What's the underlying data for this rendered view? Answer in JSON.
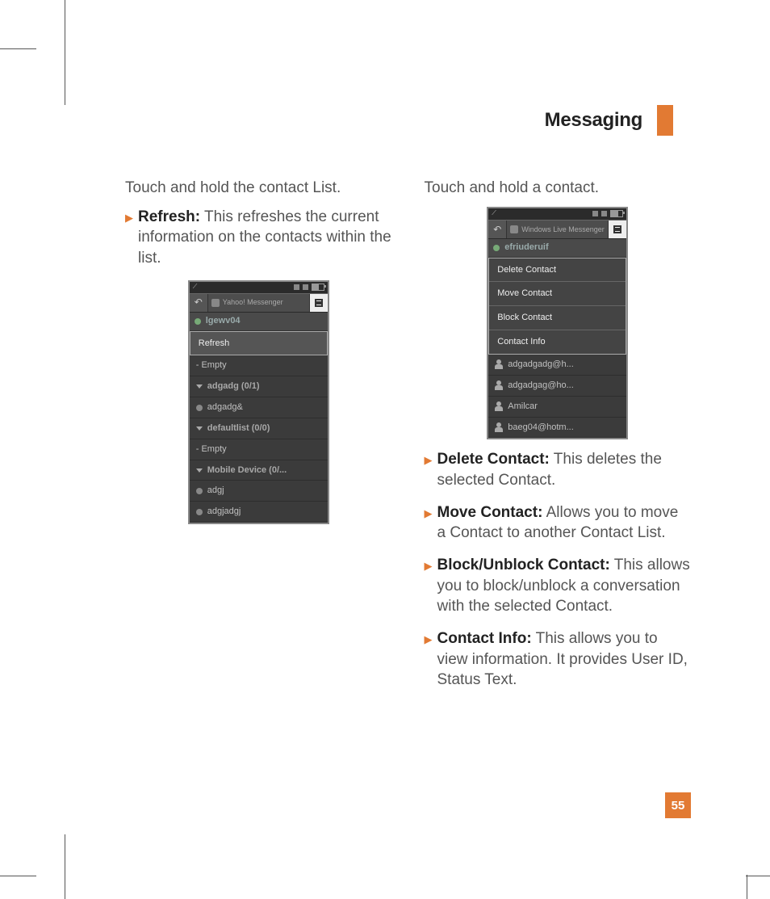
{
  "header": {
    "title": "Messaging"
  },
  "page_number": "55",
  "left": {
    "lead": "Touch and hold the contact List.",
    "bullets": [
      {
        "head": "Refresh:",
        "body": " This refreshes the current information on the contacts within the list."
      }
    ],
    "shot": {
      "app_title": "Yahoo! Messenger",
      "user": "lgewv04",
      "popup_items": [
        "Refresh"
      ],
      "list": [
        {
          "type": "sub",
          "label": "-   Empty"
        },
        {
          "type": "grp",
          "label": "adgadg (0/1)"
        },
        {
          "type": "sub",
          "icon": "dot",
          "label": "adgadg&"
        },
        {
          "type": "grp",
          "label": "defaultlist (0/0)"
        },
        {
          "type": "sub",
          "label": "-   Empty"
        },
        {
          "type": "grp",
          "label": "Mobile Device (0/..."
        },
        {
          "type": "sub",
          "icon": "dot",
          "label": "adgj"
        },
        {
          "type": "sub",
          "icon": "dot",
          "label": "adgjadgj"
        }
      ]
    }
  },
  "right": {
    "lead": "Touch and hold a contact.",
    "bullets": [
      {
        "head": "Delete Contact:",
        "body": " This deletes the selected Contact."
      },
      {
        "head": "Move Contact:",
        "body": " Allows you to move a Contact to another Contact List."
      },
      {
        "head": "Block/Unblock Contact:",
        "body": " This allows you to block/unblock a conversation with the selected Contact."
      },
      {
        "head": "Contact Info:",
        "body": " This allows you to view information. It provides User ID, Status Text."
      }
    ],
    "shot": {
      "app_title": "Windows Live Messenger",
      "user": "efriuderuif",
      "popup_items": [
        "Delete Contact",
        "Move Contact",
        "Block Contact",
        "Contact Info"
      ],
      "list": [
        {
          "type": "sub",
          "icon": "person",
          "label": "adgadgadg@h..."
        },
        {
          "type": "sub",
          "icon": "person",
          "label": "adgadgag@ho..."
        },
        {
          "type": "sub",
          "icon": "person",
          "label": "Amilcar"
        },
        {
          "type": "sub",
          "icon": "person",
          "label": "baeg04@hotm..."
        }
      ]
    }
  }
}
